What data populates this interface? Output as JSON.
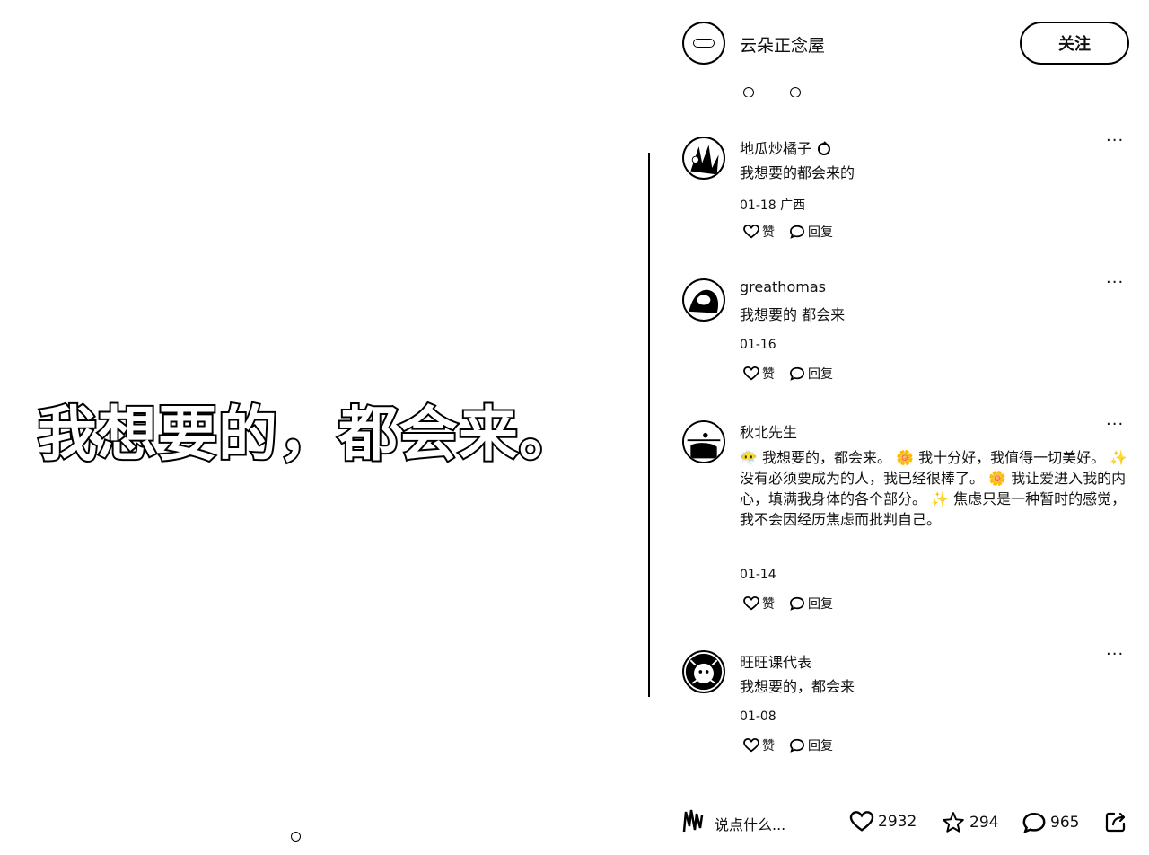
{
  "post": {
    "overlay_text": "我想要的，都会来。"
  },
  "header": {
    "author_name": "云朵正念屋",
    "follow_label": "关注"
  },
  "comments": [
    {
      "name": "地瓜炒橘子",
      "text": "我想要的都会来的",
      "meta": "01-18 广西",
      "like_label": "赞",
      "reply_label": "回复",
      "more": "···"
    },
    {
      "name": "greathomas",
      "text": "我想要的 都会来",
      "meta": "01-16",
      "like_label": "赞",
      "reply_label": "回复",
      "more": "···"
    },
    {
      "name": "秋北先生",
      "text": "😶‍🌫️ 我想要的，都会来。 🌼 我十分好，我值得一切美好。 ✨ 没有必须要成为的人，我已经很棒了。 🌼 我让爱进入我的内心，填满我身体的各个部分。 ✨ 焦虑只是一种暂时的感觉，我不会因经历焦虑而批判自己。",
      "meta": "01-14",
      "like_label": "赞",
      "reply_label": "回复",
      "more": "···"
    },
    {
      "name": "旺旺课代表",
      "text": "我想要的，都会来",
      "meta": "01-08",
      "like_label": "赞",
      "reply_label": "回复",
      "more": "···"
    }
  ],
  "bottom_bar": {
    "input_placeholder": "说点什么...",
    "likes": "2932",
    "favorites": "294",
    "comments": "965"
  },
  "icons": [
    "heart-icon",
    "star-icon",
    "comment-icon",
    "share-icon",
    "more-icon"
  ]
}
